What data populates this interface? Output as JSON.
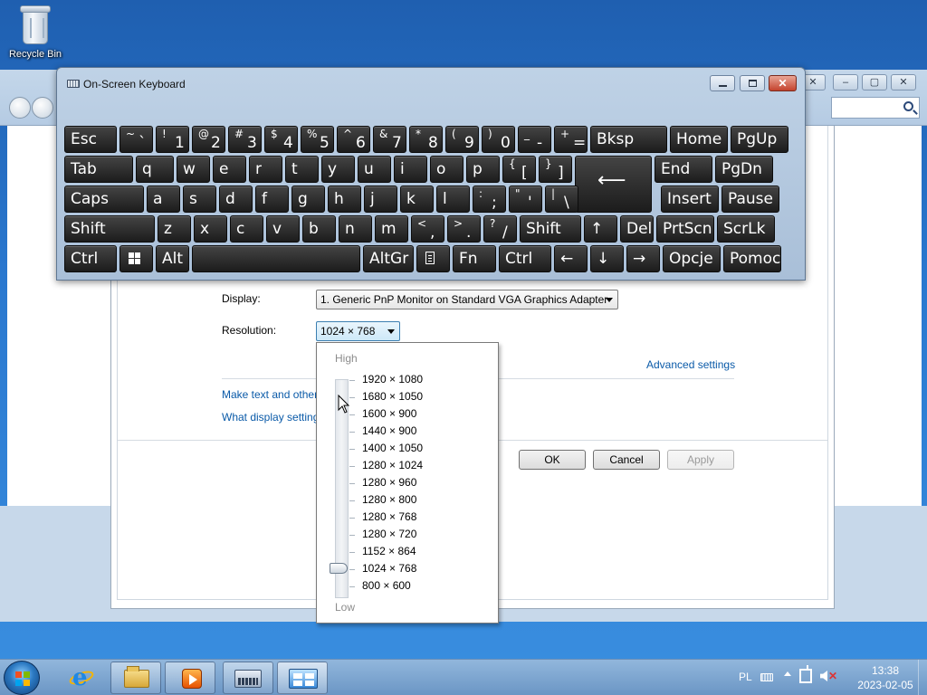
{
  "desktop": {
    "recycle_bin_label": "Recycle Bin"
  },
  "osk": {
    "title": "On-Screen Keyboard",
    "rows": [
      [
        {
          "main": "Esc"
        },
        {
          "small": "~",
          "big": "`"
        },
        {
          "small": "!",
          "big": "1"
        },
        {
          "small": "@",
          "big": "2"
        },
        {
          "small": "#",
          "big": "3"
        },
        {
          "small": "$",
          "big": "4"
        },
        {
          "small": "%",
          "big": "5"
        },
        {
          "small": "^",
          "big": "6"
        },
        {
          "small": "&",
          "big": "7"
        },
        {
          "small": "*",
          "big": "8"
        },
        {
          "small": "(",
          "big": "9"
        },
        {
          "small": ")",
          "big": "0"
        },
        {
          "small": "_",
          "big": "-"
        },
        {
          "small": "+",
          "big": "="
        },
        {
          "main": "Bksp"
        },
        {
          "main": "Home"
        },
        {
          "main": "PgUp"
        }
      ],
      [
        {
          "main": "Tab"
        },
        {
          "main": "q"
        },
        {
          "main": "w"
        },
        {
          "main": "e"
        },
        {
          "main": "r"
        },
        {
          "main": "t"
        },
        {
          "main": "y"
        },
        {
          "main": "u"
        },
        {
          "main": "i"
        },
        {
          "main": "o"
        },
        {
          "main": "p"
        },
        {
          "small": "{",
          "big": "["
        },
        {
          "small": "}",
          "big": "]"
        },
        {
          "main": "End"
        },
        {
          "main": "PgDn"
        }
      ],
      [
        {
          "main": "Caps"
        },
        {
          "main": "a"
        },
        {
          "main": "s"
        },
        {
          "main": "d"
        },
        {
          "main": "f"
        },
        {
          "main": "g"
        },
        {
          "main": "h"
        },
        {
          "main": "j"
        },
        {
          "main": "k"
        },
        {
          "main": "l"
        },
        {
          "small": ":",
          "big": ";"
        },
        {
          "small": "\"",
          "big": "'"
        },
        {
          "small": "|",
          "big": "\\"
        },
        {
          "main": "Insert"
        },
        {
          "main": "Pause"
        }
      ],
      [
        {
          "main": "Shift"
        },
        {
          "main": "z"
        },
        {
          "main": "x"
        },
        {
          "main": "c"
        },
        {
          "main": "v"
        },
        {
          "main": "b"
        },
        {
          "main": "n"
        },
        {
          "main": "m"
        },
        {
          "small": "<",
          "big": ","
        },
        {
          "small": ">",
          "big": "."
        },
        {
          "small": "?",
          "big": "/"
        },
        {
          "main": "Shift"
        },
        {
          "main": "↑"
        },
        {
          "main": "Del"
        },
        {
          "main": "PrtScn"
        },
        {
          "main": "ScrLk"
        }
      ],
      [
        {
          "main": "Ctrl"
        },
        {
          "icon": "windows-logo-icon"
        },
        {
          "main": "Alt"
        },
        {
          "main": ""
        },
        {
          "main": "AltGr"
        },
        {
          "icon": "menu-key-icon"
        },
        {
          "main": "Fn"
        },
        {
          "main": "Ctrl"
        },
        {
          "main": "←"
        },
        {
          "main": "↓"
        },
        {
          "main": "→"
        },
        {
          "main": "Opcje"
        },
        {
          "main": "Pomoc"
        }
      ]
    ],
    "enter_glyph": "⟵"
  },
  "resolution_window": {
    "display_label": "Display:",
    "display_value": "1. Generic PnP Monitor on Standard VGA Graphics Adapter",
    "resolution_label": "Resolution:",
    "resolution_value": "1024 × 768",
    "advanced_link": "Advanced settings",
    "link_text_size": "Make text and other",
    "link_display_settings": "What display setting",
    "ok": "OK",
    "cancel": "Cancel",
    "apply": "Apply"
  },
  "resolution_panel": {
    "high": "High",
    "low": "Low",
    "options": [
      "1920 × 1080",
      "1680 × 1050",
      "1600 × 900",
      "1440 × 900",
      "1400 × 1050",
      "1280 × 1024",
      "1280 × 960",
      "1280 × 800",
      "1280 × 768",
      "1280 × 720",
      "1152 × 864",
      "1024 × 768",
      "800 × 600"
    ],
    "selected": "1024 × 768"
  },
  "taskbar": {
    "language": "PL",
    "time": "13:38",
    "date": "2023-02-05",
    "accent": "#2b79c2"
  }
}
